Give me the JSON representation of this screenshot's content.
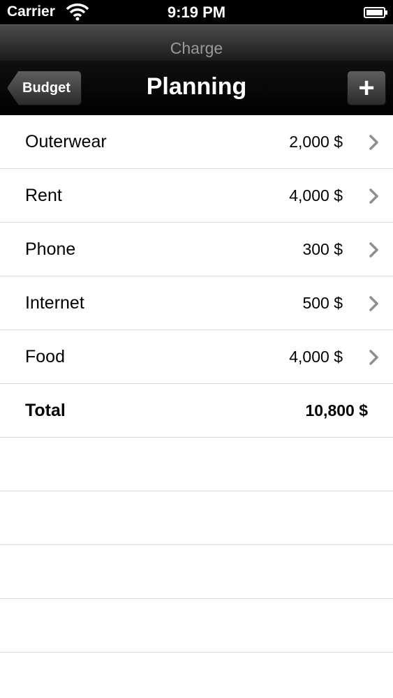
{
  "status_bar": {
    "carrier": "Carrier",
    "time": "9:19 PM",
    "wifi_icon": "wifi-icon",
    "battery_icon": "battery-icon"
  },
  "nav": {
    "prompt": "Charge",
    "back_label": "Budget",
    "title": "Planning",
    "add_label": "+"
  },
  "items": [
    {
      "name": "Outerwear",
      "amount": "2,000 $"
    },
    {
      "name": "Rent",
      "amount": "4,000 $"
    },
    {
      "name": "Phone",
      "amount": "300 $"
    },
    {
      "name": "Internet",
      "amount": "500 $"
    },
    {
      "name": "Food",
      "amount": "4,000 $"
    }
  ],
  "total": {
    "label": "Total",
    "amount": "10,800 $"
  },
  "colors": {
    "separator": "#d9d9d9",
    "chevron": "#8e8e8e",
    "prompt_text": "#9a9a9a"
  }
}
